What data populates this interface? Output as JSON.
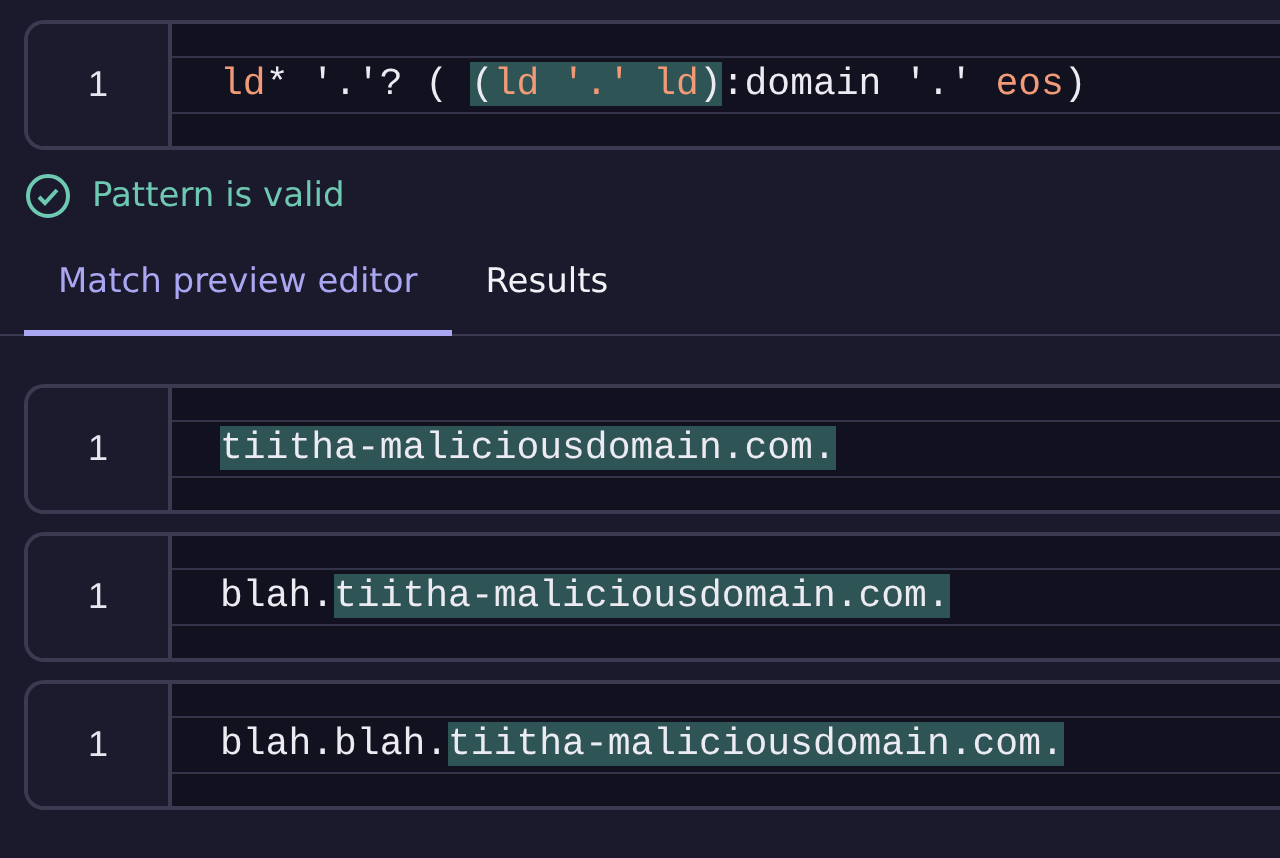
{
  "pattern_editor": {
    "line_number": "1",
    "segments": [
      {
        "text": "ld",
        "kind": "keyword",
        "highlighted": false
      },
      {
        "text": "* '.'? ( ",
        "kind": "plain",
        "highlighted": false
      },
      {
        "text": "(",
        "kind": "plain",
        "highlighted": true
      },
      {
        "text": "ld '.' ld",
        "kind": "keyword",
        "highlighted": true
      },
      {
        "text": ")",
        "kind": "plain",
        "highlighted": true
      },
      {
        "text": ":domain '.' ",
        "kind": "plain",
        "highlighted": false
      },
      {
        "text": "eos",
        "kind": "keyword",
        "highlighted": false
      },
      {
        "text": ")",
        "kind": "plain",
        "highlighted": false
      }
    ]
  },
  "validation": {
    "valid": true,
    "message": "Pattern is valid"
  },
  "tabs": [
    {
      "label": "Match preview editor",
      "selected": true
    },
    {
      "label": "Results",
      "selected": false
    }
  ],
  "samples": [
    {
      "line_number": "1",
      "segments": [
        {
          "text": "tiitha-maliciousdomain.com.",
          "highlighted": true
        }
      ]
    },
    {
      "line_number": "1",
      "segments": [
        {
          "text": "blah.",
          "highlighted": false
        },
        {
          "text": "tiitha-maliciousdomain.com.",
          "highlighted": true
        }
      ]
    },
    {
      "line_number": "1",
      "segments": [
        {
          "text": "blah.blah.",
          "highlighted": false
        },
        {
          "text": "tiitha-maliciousdomain.com.",
          "highlighted": true
        }
      ]
    }
  ]
}
